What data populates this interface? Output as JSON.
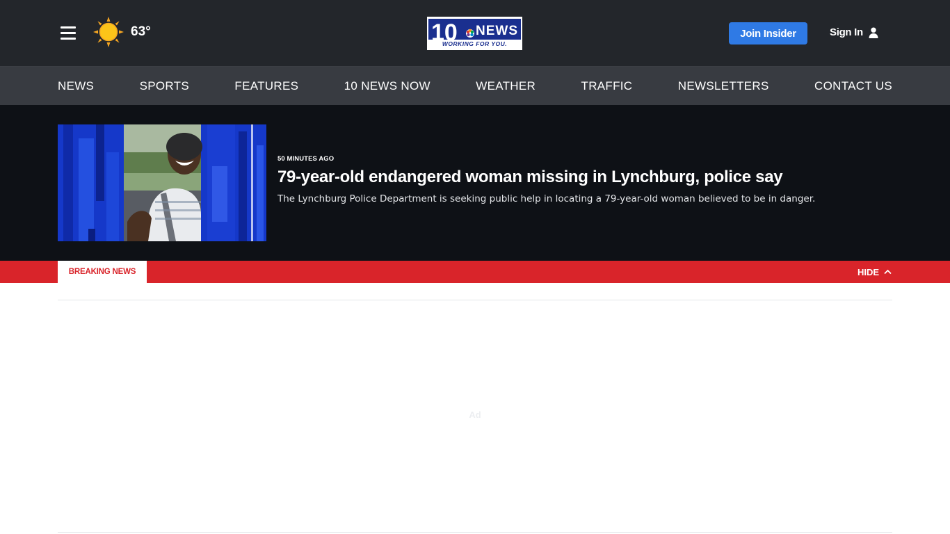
{
  "header": {
    "weather": {
      "icon": "sun-icon",
      "temperature": "63°"
    },
    "logo": {
      "main": "NEWS",
      "number": "10",
      "tagline": "WORKING FOR YOU."
    },
    "join_label": "Join Insider",
    "signin_label": "Sign In",
    "colors": {
      "background": "#23262b",
      "join_button": "#2f7ae5"
    }
  },
  "nav": {
    "items": [
      {
        "label": "NEWS"
      },
      {
        "label": "SPORTS"
      },
      {
        "label": "FEATURES"
      },
      {
        "label": "10 NEWS NOW"
      },
      {
        "label": "WEATHER"
      },
      {
        "label": "TRAFFIC"
      },
      {
        "label": "NEWSLETTERS"
      },
      {
        "label": "CONTACT US"
      }
    ]
  },
  "breaking_story": {
    "time": "50 MINUTES AGO",
    "headline": "79-year-old endangered woman missing in Lynchburg, police say",
    "summary": "The Lynchburg Police Department is seeking public help in locating a 79-year-old woman believed to be in danger."
  },
  "breaking_bar": {
    "label": "BREAKING NEWS",
    "hide_label": "HIDE",
    "color": "#d9242a"
  },
  "ad": {
    "label": "Ad"
  }
}
